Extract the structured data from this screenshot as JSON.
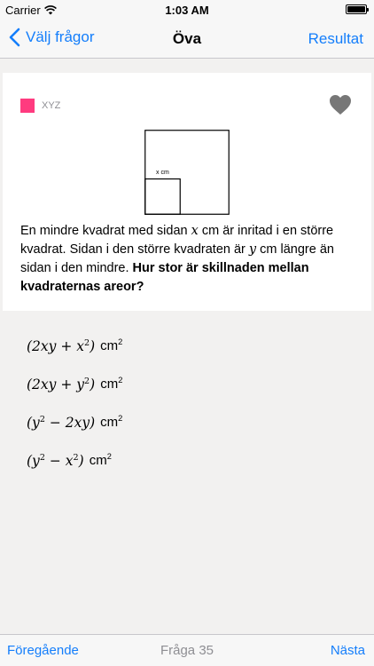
{
  "status_bar": {
    "carrier": "Carrier",
    "time": "1:03 AM",
    "icons": [
      "wifi-icon",
      "battery-icon"
    ]
  },
  "nav": {
    "back_label": "Välj frågor",
    "title": "Öva",
    "right_label": "Resultat"
  },
  "question": {
    "tag_label": "XYZ",
    "tag_color": "#ff3b7f",
    "favorite_icon": "heart-icon",
    "figure_label": "x cm",
    "text_parts": {
      "p1": "En mindre kvadrat med sidan ",
      "var_x": "x",
      "p2": " cm är inritad i en större kvadrat. Sidan i den större kvadraten är ",
      "var_y": "y",
      "p3": " cm längre än sidan i den mindre. ",
      "bold": "Hur stor är skillnaden mellan kvadraternas areor?"
    }
  },
  "answers": [
    {
      "expr": "(2xy + x",
      "sup": "2",
      "close": ")",
      "unit": "cm",
      "unit_sup": "2"
    },
    {
      "expr": "(2xy + y",
      "sup": "2",
      "close": ")",
      "unit": "cm",
      "unit_sup": "2"
    },
    {
      "expr": "(y",
      "sup": "2",
      "close": " − 2xy)",
      "unit": "cm",
      "unit_sup": "2"
    },
    {
      "expr": "(y",
      "sup": "2",
      "close": " − x",
      "sup2": "2",
      "close2": ")",
      "unit": "cm",
      "unit_sup": "2"
    }
  ],
  "toolbar": {
    "prev_label": "Föregående",
    "count_label": "Fråga 35",
    "next_label": "Nästa"
  },
  "colors": {
    "accent": "#147efb",
    "background": "#f2f1f0"
  }
}
